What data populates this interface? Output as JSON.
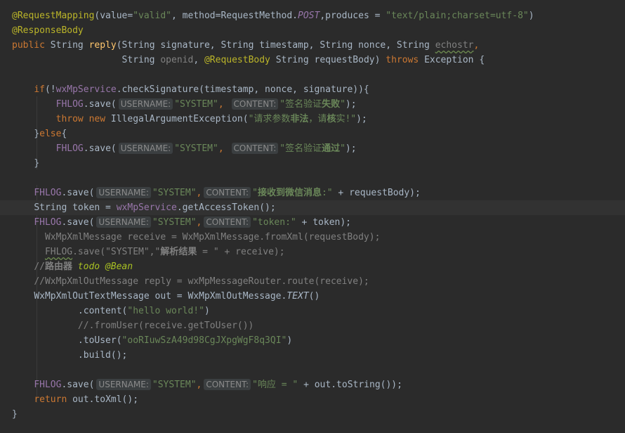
{
  "code": {
    "l1": {
      "a": "@RequestMapping",
      "b": "(value=",
      "c": "\"valid\"",
      "d": ", method=RequestMethod.",
      "e": "POST",
      "f": ",produces = ",
      "g": "\"text/plain;charset=utf-8\"",
      "h": ")"
    },
    "l2": {
      "a": "@ResponseBody"
    },
    "l3": {
      "a": "public ",
      "b": "String ",
      "c": "reply",
      "d": "(String signature, String timestamp, String nonce, String ",
      "e": "echostr",
      ",f": "",
      "f": ","
    },
    "l4": {
      "pad": "                    ",
      "a": "String ",
      "b": "openid",
      ",c": "",
      "c": ", ",
      "d": "@RequestBody ",
      "e": "String requestBody) ",
      "f": "throws ",
      "g": "Exception {"
    },
    "l6": {
      "pad": "    ",
      "a": "if",
      "b": "(!",
      "c": "wxMpService",
      ".d": "",
      "d": ".checkSignature(timestamp, nonce, signature)){"
    },
    "l7": {
      "pad": "        ",
      "a": "FHLOG",
      ".b": "",
      "b": ".save(",
      "h1": "USERNAME:",
      "c": "\"SYSTEM\"",
      "d": ", ",
      "h2": "CONTENT:",
      "e": "\"签名验证",
      "f": "失败",
      "g": "\"",
      ")": "",
      "h": ");"
    },
    "l8": {
      "pad": "        ",
      "a": "throw new ",
      "b": "IllegalArgumentException(",
      "c": "\"请求参数",
      "d": "非法",
      "e": "，请",
      "f": "核",
      "g": "实!\"",
      "h": ");"
    },
    "l9": {
      "pad": "    ",
      "a": "}",
      "b": "else",
      "c": "{"
    },
    "l10": {
      "pad": "        ",
      "a": "FHLOG",
      "b": ".save(",
      "h1": "USERNAME:",
      "c": "\"SYSTEM\"",
      "d": ", ",
      "h2": "CONTENT:",
      "e": "\"签名验证",
      "f": "通过",
      "g": "\"",
      "h": ");"
    },
    "l11": {
      "pad": "    ",
      "a": "}"
    },
    "l13": {
      "pad": "    ",
      "a": "FHLOG",
      "b": ".save(",
      "h1": "USERNAME:",
      "c": "\"SYSTEM\"",
      "d": ",",
      "h2": "CONTENT:",
      "e": "\"",
      "f": "接收到微信消息",
      "g": ":\"",
      "h": " + requestBody);"
    },
    "l14": {
      "pad": "    ",
      "a": "String token = ",
      "b": "wxMpService",
      "c": ".getAccessToken();"
    },
    "l15": {
      "pad": "    ",
      "a": "FHLOG",
      "b": ".save(",
      "h1": "USERNAME:",
      "c": "\"SYSTEM\"",
      "d": ",",
      "h2": "CONTENT:",
      "e": "\"token:\"",
      "f": " + token);"
    },
    "l16": {
      "pad": "      ",
      "a": "WxMpXmlMessage receive = WxMpXmlMessage.fromXml(requestBody);"
    },
    "l17": {
      "pad": "      ",
      "a": "FHLOG",
      "b": ".save(\"SYSTEM\",\"",
      "c": "解析结果",
      "d": " = \" + receive);"
    },
    "l18": {
      "pad": "    ",
      "a": "//",
      "b": "路由器 ",
      "c": "todo @Bean"
    },
    "l19": {
      "pad": "    ",
      "a": "//WxMpXmlOutMessage reply = wxMpMessageRouter.route(receive);"
    },
    "l20": {
      "pad": "    ",
      "a": "WxMpXmlOutTextMessage out = WxMpXmlOutMessage.",
      "b": "TEXT",
      "c": "()"
    },
    "l21": {
      "pad": "            ",
      "a": ".content(",
      "b": "\"hello world!\"",
      "c": ")"
    },
    "l22": {
      "pad": "            ",
      "a": "//.fromUser(receive.getToUser())"
    },
    "l23": {
      "pad": "            ",
      "a": ".toUser(",
      "b": "\"ooRIuwSzA49d98CgJXpgWgF8q3QI\"",
      "c": ")"
    },
    "l24": {
      "pad": "            ",
      "a": ".build();"
    },
    "l26": {
      "pad": "    ",
      "a": "FHLOG",
      "b": ".save(",
      "h1": "USERNAME:",
      "c": "\"SYSTEM\"",
      "d": ",",
      "h2": "CONTENT:",
      "e": "\"响应 = \"",
      "f": " + out.toString());"
    },
    "l27": {
      "pad": "    ",
      "a": "return ",
      "b": "out.toXml();"
    },
    "l28": {
      "a": "}"
    }
  }
}
